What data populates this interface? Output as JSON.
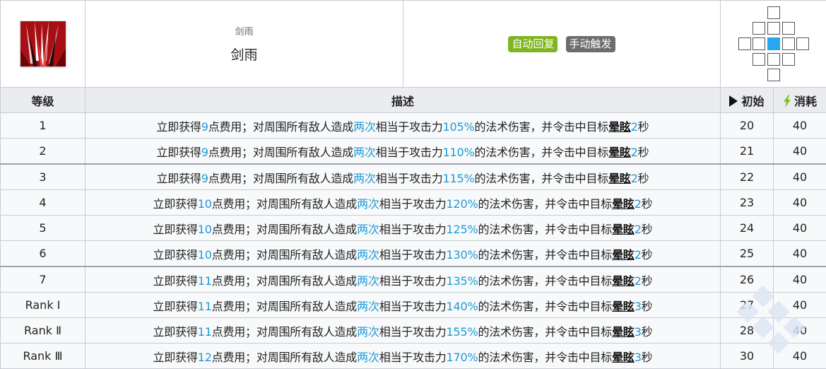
{
  "skill": {
    "icon": "sword-rain-skill-icon",
    "name_small": "剑雨",
    "name": "剑雨",
    "tags": {
      "recovery": "自动回复",
      "trigger": "手动触发"
    },
    "colors": {
      "recovery": "#7fb51e",
      "trigger": "#6d6d6d",
      "highlight": "#1f9bd6",
      "range_self": "#27a6f3"
    }
  },
  "range": {
    "icon": "attack-range-grid-icon",
    "self_color": "#27a6f3"
  },
  "columns": {
    "level": "等级",
    "description": "描述",
    "initial": "初始",
    "initial_icon": "play-arrow-icon",
    "cost": "消耗",
    "cost_icon": "lightning-bolt-icon"
  },
  "desc_text": {
    "p1": "立即获得",
    "p2": "点费用；对周围所有敌人造成",
    "hits": "两次",
    "p3": "相当于攻击力",
    "p4": "的法术伤害，并令击中目标",
    "stun": "晕眩",
    "p5": "秒"
  },
  "rows": [
    {
      "level": "1",
      "sp": "9",
      "atk": "105%",
      "stun_sec": "2",
      "initial": "20",
      "cost": "40"
    },
    {
      "level": "2",
      "sp": "9",
      "atk": "110%",
      "stun_sec": "2",
      "initial": "21",
      "cost": "40"
    },
    {
      "level": "3",
      "sp": "9",
      "atk": "115%",
      "stun_sec": "2",
      "initial": "22",
      "cost": "40"
    },
    {
      "level": "4",
      "sp": "10",
      "atk": "120%",
      "stun_sec": "2",
      "initial": "23",
      "cost": "40"
    },
    {
      "level": "5",
      "sp": "10",
      "atk": "125%",
      "stun_sec": "2",
      "initial": "24",
      "cost": "40"
    },
    {
      "level": "6",
      "sp": "10",
      "atk": "130%",
      "stun_sec": "2",
      "initial": "25",
      "cost": "40"
    },
    {
      "level": "7",
      "sp": "11",
      "atk": "135%",
      "stun_sec": "2",
      "initial": "26",
      "cost": "40"
    },
    {
      "level": "Rank Ⅰ",
      "sp": "11",
      "atk": "140%",
      "stun_sec": "3",
      "initial": "27",
      "cost": "40"
    },
    {
      "level": "Rank Ⅱ",
      "sp": "11",
      "atk": "155%",
      "stun_sec": "3",
      "initial": "28",
      "cost": "40"
    },
    {
      "level": "Rank Ⅲ",
      "sp": "12",
      "atk": "170%",
      "stun_sec": "3",
      "initial": "30",
      "cost": "40"
    }
  ]
}
